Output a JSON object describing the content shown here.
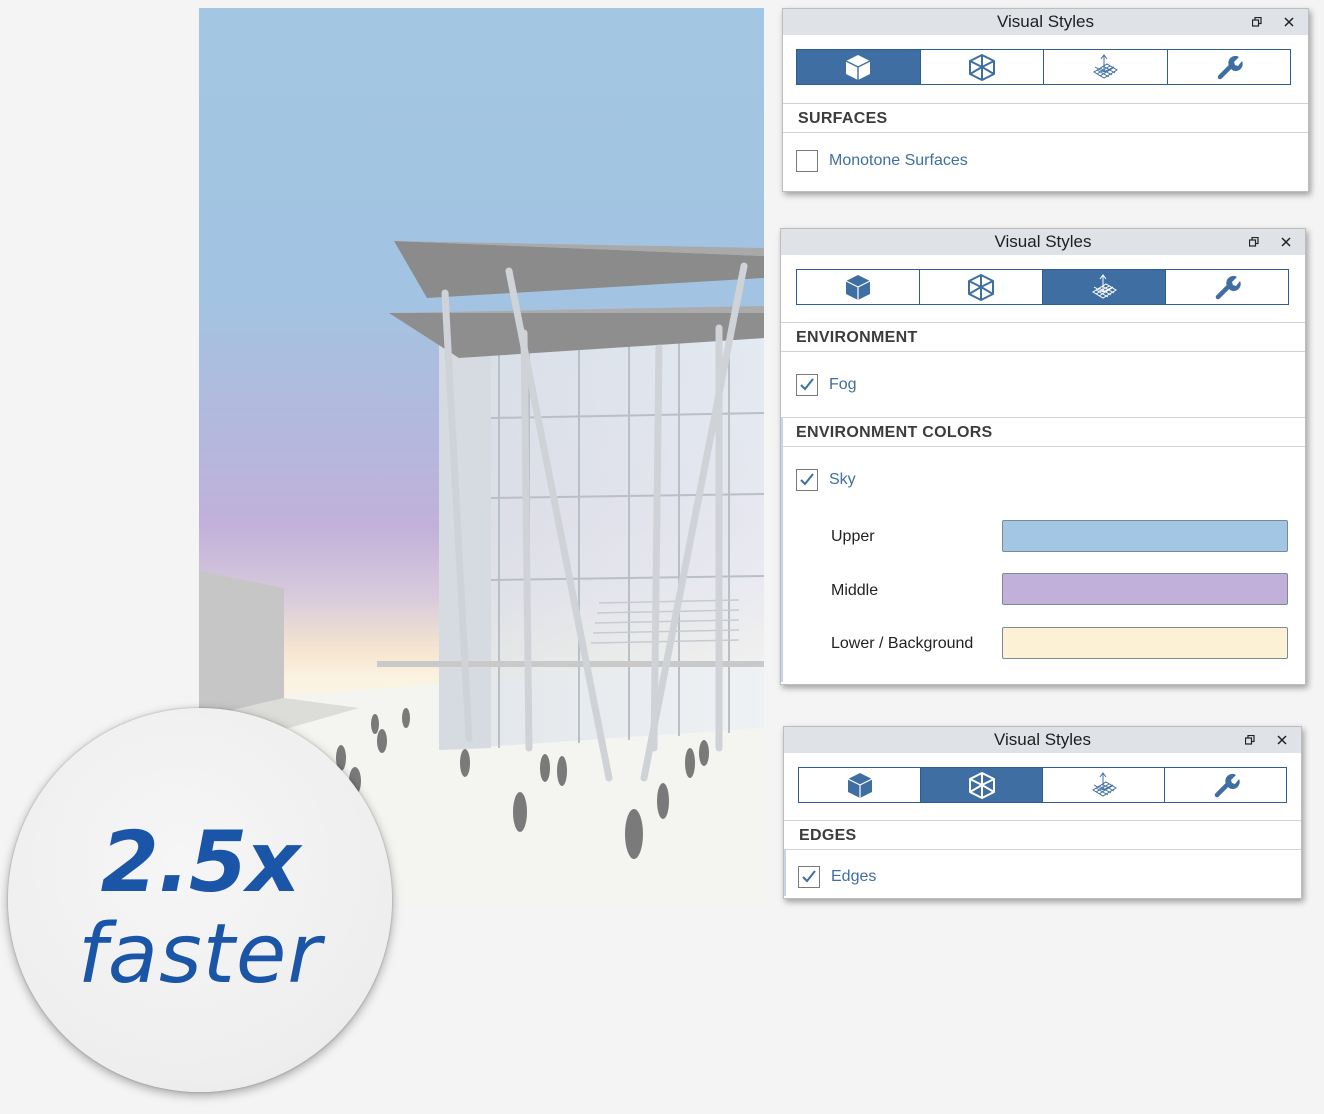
{
  "badge": {
    "number": "2.5x",
    "word": "faster"
  },
  "panels": {
    "surfaces": {
      "title": "Visual Styles",
      "section": "SURFACES",
      "checkbox_label": "Monotone Surfaces",
      "checked": false
    },
    "environment": {
      "title": "Visual Styles",
      "section1": "ENVIRONMENT",
      "fog_label": "Fog",
      "fog_checked": true,
      "section2": "ENVIRONMENT COLORS",
      "sky_label": "Sky",
      "sky_checked": true,
      "colors": [
        {
          "label": "Upper",
          "color": "#a3c6e4"
        },
        {
          "label": "Middle",
          "color": "#c0b0da"
        },
        {
          "label": "Lower / Background",
          "color": "#fdf1d5"
        }
      ]
    },
    "edges": {
      "title": "Visual Styles",
      "section": "EDGES",
      "edges_label": "Edges",
      "edges_checked": true
    }
  },
  "tab_icons": [
    "cube-icon",
    "wireframe-cube-icon",
    "environment-grid-icon",
    "wrench-icon"
  ],
  "theme": {
    "accent": "#3f6ea3",
    "label_blue": "#3f6ea3",
    "badge_blue": "#1a55a8"
  }
}
